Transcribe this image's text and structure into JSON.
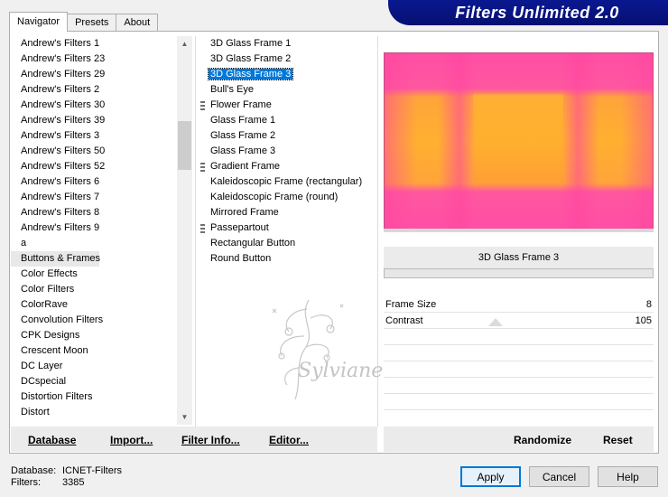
{
  "banner": {
    "title": "Filters Unlimited 2.0"
  },
  "tabs": [
    {
      "label": "Navigator",
      "active": true
    },
    {
      "label": "Presets",
      "active": false
    },
    {
      "label": "About",
      "active": false
    }
  ],
  "categories": [
    "Andrew's Filters 1",
    "Andrew's Filters 23",
    "Andrew's Filters 29",
    "Andrew's Filters 2",
    "Andrew's Filters 30",
    "Andrew's Filters 39",
    "Andrew's Filters 3",
    "Andrew's Filters 50",
    "Andrew's Filters 52",
    "Andrew's Filters 6",
    "Andrew's Filters 7",
    "Andrew's Filters 8",
    "Andrew's Filters 9",
    "a",
    "Buttons & Frames",
    "Color Effects",
    "Color Filters",
    "ColorRave",
    "Convolution Filters",
    "CPK Designs",
    "Crescent Moon",
    "DC Layer",
    "DCspecial",
    "Distortion Filters",
    "Distort"
  ],
  "selected_category": "Buttons & Frames",
  "filters": [
    {
      "label": "3D Glass Frame 1",
      "grip": false,
      "selected": false
    },
    {
      "label": "3D Glass Frame 2",
      "grip": false,
      "selected": false
    },
    {
      "label": "3D Glass Frame 3",
      "grip": false,
      "selected": true
    },
    {
      "label": "Bull's Eye",
      "grip": false,
      "selected": false
    },
    {
      "label": "Flower Frame",
      "grip": true,
      "selected": false
    },
    {
      "label": "Glass Frame 1",
      "grip": false,
      "selected": false
    },
    {
      "label": "Glass Frame 2",
      "grip": false,
      "selected": false
    },
    {
      "label": "Glass Frame 3",
      "grip": false,
      "selected": false
    },
    {
      "label": "Gradient Frame",
      "grip": true,
      "selected": false
    },
    {
      "label": "Kaleidoscopic Frame (rectangular)",
      "grip": false,
      "selected": false
    },
    {
      "label": "Kaleidoscopic Frame (round)",
      "grip": false,
      "selected": false
    },
    {
      "label": "Mirrored Frame",
      "grip": false,
      "selected": false
    },
    {
      "label": "Passepartout",
      "grip": true,
      "selected": false
    },
    {
      "label": "Rectangular Button",
      "grip": false,
      "selected": false
    },
    {
      "label": "Round Button",
      "grip": false,
      "selected": false
    }
  ],
  "watermark": {
    "text": "Sylviane"
  },
  "filter_name": "3D Glass Frame 3",
  "params": [
    {
      "label": "Frame Size",
      "value": "8"
    },
    {
      "label": "Contrast",
      "value": "105"
    }
  ],
  "toolbar": {
    "database": "Database",
    "import": "Import...",
    "filter_info": "Filter Info...",
    "editor": "Editor...",
    "randomize": "Randomize",
    "reset": "Reset"
  },
  "status": {
    "database_label": "Database:",
    "database_value": "ICNET-Filters",
    "filters_label": "Filters:",
    "filters_value": "3385"
  },
  "buttons": {
    "apply": "Apply",
    "cancel": "Cancel",
    "help": "Help"
  },
  "colors": {
    "selection": "#0078d7",
    "banner": "#0a1890"
  }
}
